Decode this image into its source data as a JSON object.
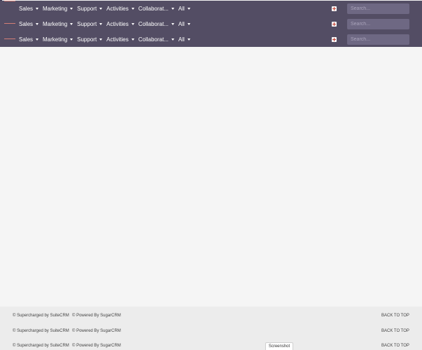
{
  "navbars": [
    {
      "menu": [
        "Sales",
        "Marketing",
        "Support",
        "Activities",
        "Collaborat...",
        "All"
      ],
      "search_placeholder": "Search..."
    },
    {
      "menu": [
        "Sales",
        "Marketing",
        "Support",
        "Activities",
        "Collaborat...",
        "All"
      ],
      "search_placeholder": "Search..."
    },
    {
      "menu": [
        "Sales",
        "Marketing",
        "Support",
        "Activities",
        "Collaborat...",
        "All"
      ],
      "search_placeholder": "Search..."
    }
  ],
  "footer": {
    "rows": [
      {
        "supercharged": "© Supercharged by SuiteCRM",
        "powered": "© Powered By SugarCRM",
        "back_to_top": "BACK TO TOP"
      },
      {
        "supercharged": "© Supercharged by SuiteCRM",
        "powered": "© Powered By SugarCRM",
        "back_to_top": "BACK TO TOP"
      },
      {
        "supercharged": "© Supercharged by SuiteCRM",
        "powered": "© Powered By SugarCRM",
        "back_to_top": "BACK TO TOP"
      }
    ]
  },
  "screenshot_button": "Screenshot",
  "icons": {
    "create": "plus-icon",
    "menu_caret": "caret-down-icon"
  },
  "colors": {
    "navbar": "#534d64",
    "search_bg": "#6e6883",
    "content_bg": "#f5f5f5",
    "footer_bg": "#ececec",
    "create_icon": "#c0392b"
  }
}
